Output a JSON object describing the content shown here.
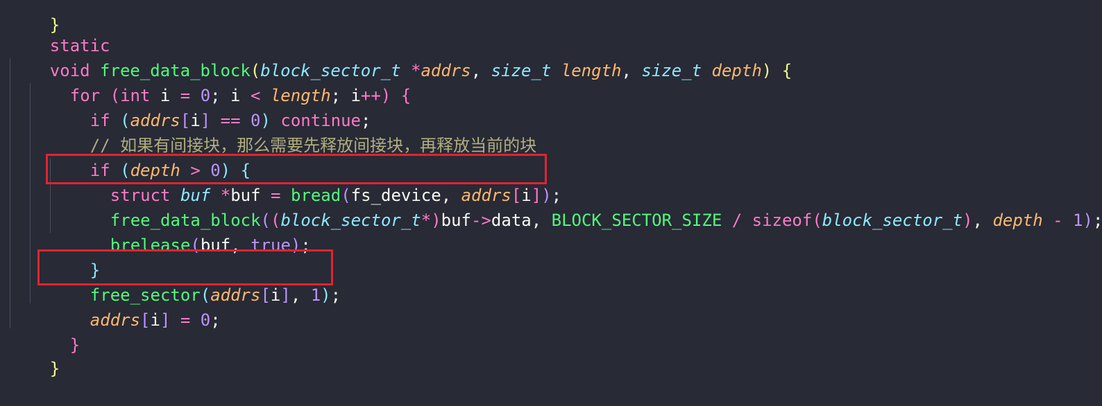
{
  "code": {
    "line0": "}",
    "line1": [
      "static"
    ],
    "line2": [
      "void",
      "free_data_block",
      "(",
      "block_sector_t",
      "*",
      "addrs",
      ",",
      "size_t",
      "length",
      ",",
      "size_t",
      "depth",
      ")",
      "{"
    ],
    "line3": [
      "for",
      "(",
      "int",
      "i",
      "=",
      "0",
      ";",
      "i",
      "<",
      "length",
      ";",
      "i",
      "++",
      ")",
      "{"
    ],
    "line4": [
      "if",
      "(",
      "addrs",
      "[",
      "i",
      "]",
      "==",
      "0",
      ")",
      "continue",
      ";"
    ],
    "line5": "// 如果有间接块，那么需要先释放间接块，再释放当前的块",
    "line6": [
      "if",
      "(",
      "depth",
      ">",
      "0",
      ")",
      "{"
    ],
    "line7": [
      "struct",
      "buf",
      "*",
      "buf",
      "=",
      "bread",
      "(",
      "fs_device",
      ",",
      "addrs",
      "[",
      "i",
      "]",
      ")",
      ";"
    ],
    "line8": [
      "free_data_block",
      "(",
      "(",
      "block_sector_t",
      "*",
      ")",
      "buf",
      "->",
      "data",
      ",",
      "BLOCK_SECTOR_SIZE",
      "/",
      "sizeof",
      "(",
      "block_sector_t",
      ")",
      ",",
      "depth",
      "-",
      "1",
      ")",
      ";"
    ],
    "line9": [
      "brelease",
      "(",
      "buf",
      ",",
      "true",
      ")",
      ";"
    ],
    "line10": "}",
    "line11": [
      "free_sector",
      "(",
      "addrs",
      "[",
      "i",
      "]",
      ",",
      "1",
      ")",
      ";"
    ],
    "line12": [
      "addrs",
      "[",
      "i",
      "]",
      "=",
      "0",
      ";"
    ],
    "line13": "}",
    "line14": "}"
  },
  "colors": {
    "background": "#282a36",
    "keyword": "#ff79c6",
    "type": "#8be9fd",
    "function": "#50fa7b",
    "parameter": "#ffb86c",
    "number": "#bd93f9",
    "comment": "#b0ad7e",
    "highlight_box": "#e0242f"
  }
}
